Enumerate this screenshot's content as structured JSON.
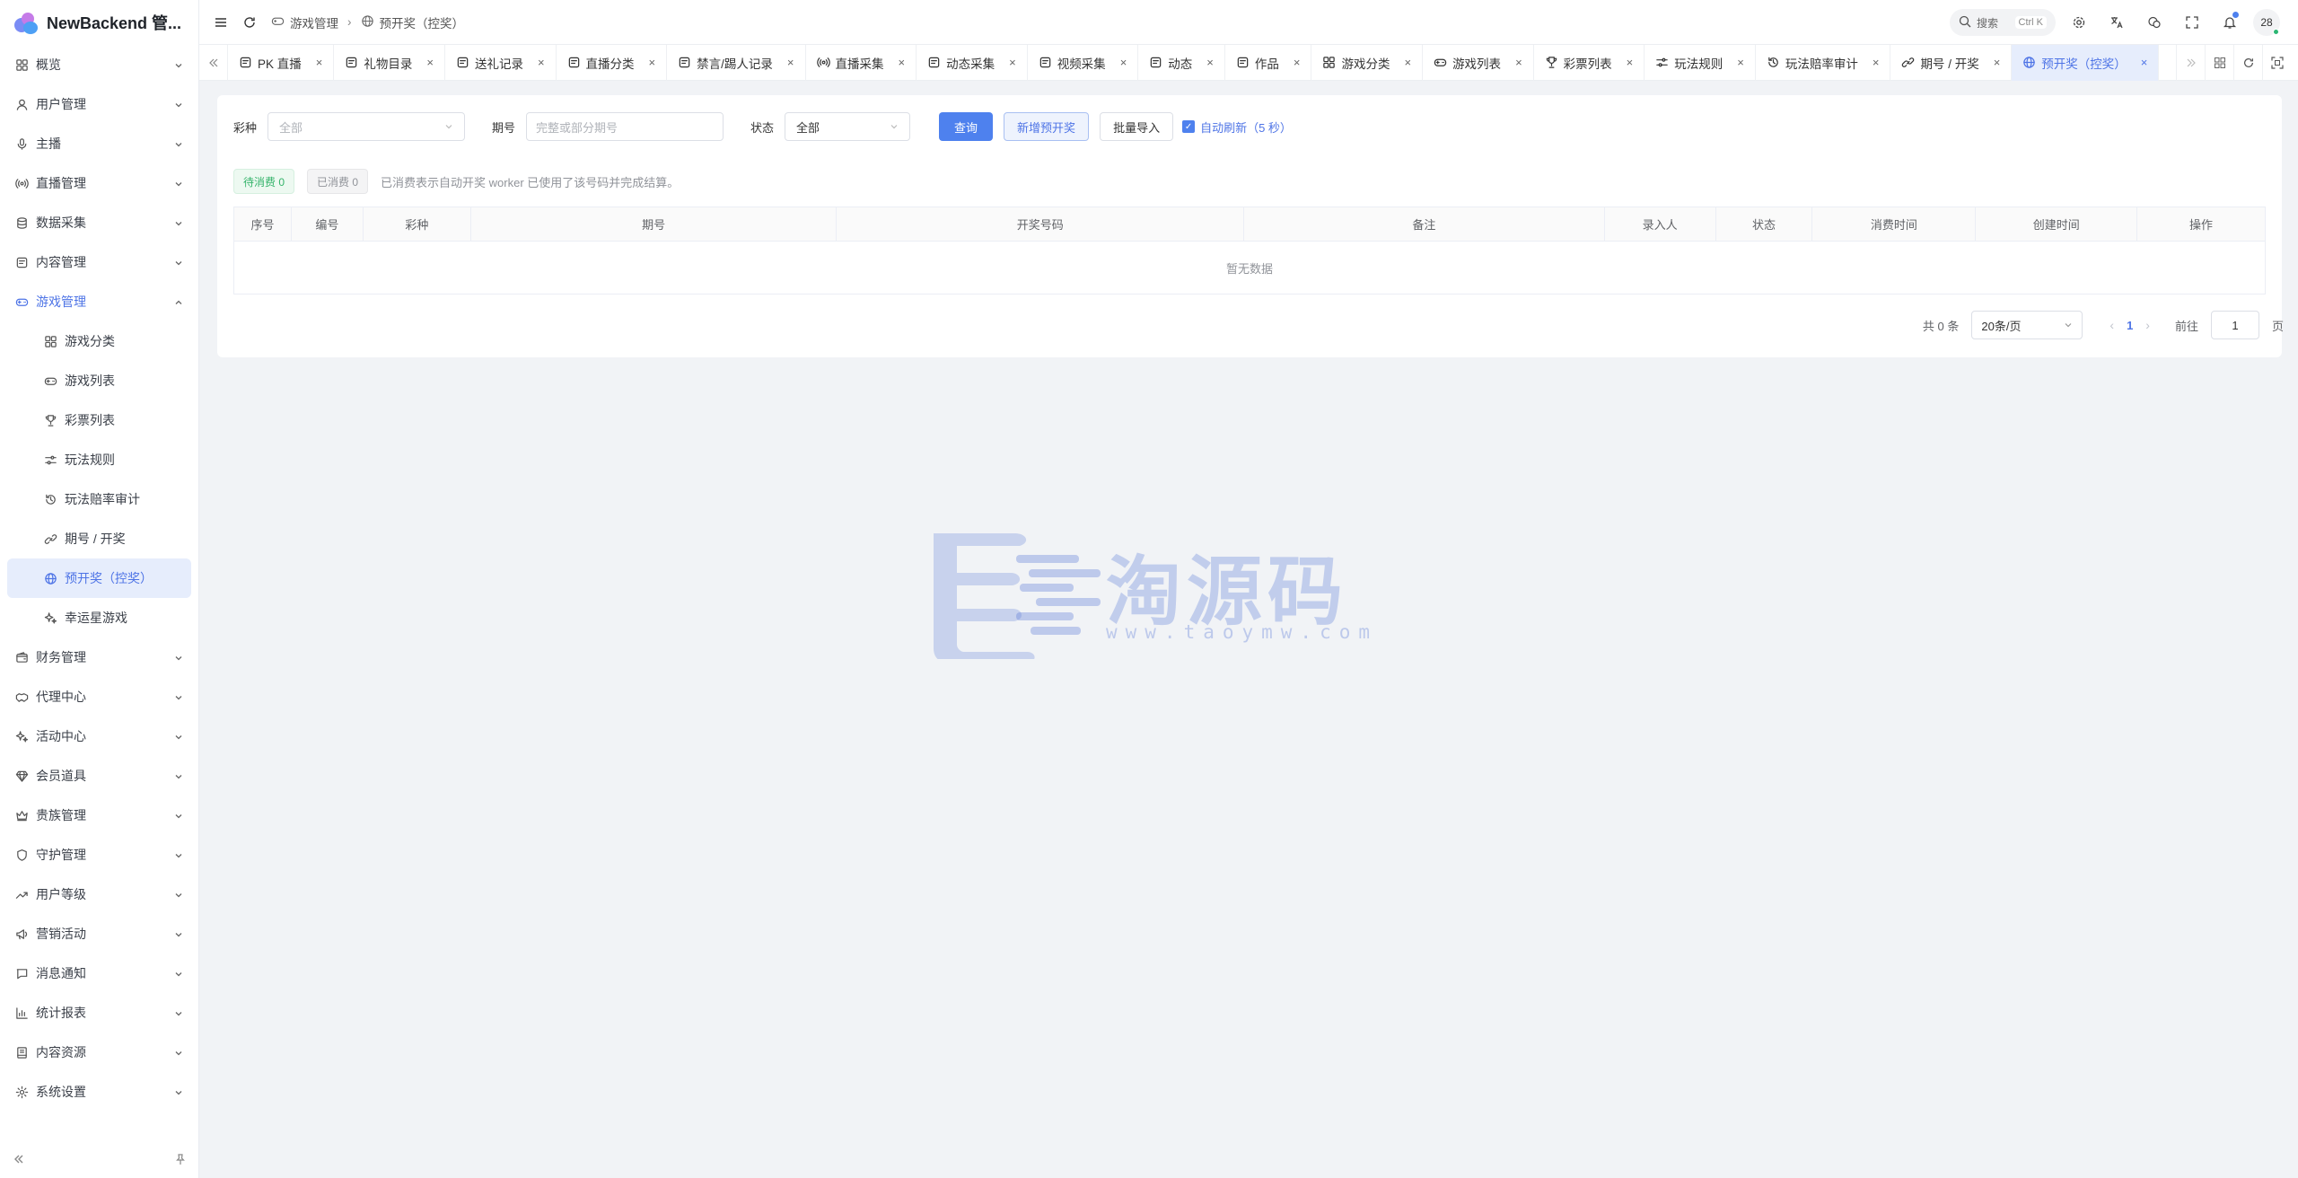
{
  "app": {
    "title": "NewBackend 管..."
  },
  "sidebar": {
    "items": [
      {
        "label": "概览",
        "icon": "grid-icon"
      },
      {
        "label": "用户管理",
        "icon": "user-icon"
      },
      {
        "label": "主播",
        "icon": "mic-icon"
      },
      {
        "label": "直播管理",
        "icon": "broadcast-icon"
      },
      {
        "label": "数据采集",
        "icon": "database-icon"
      },
      {
        "label": "内容管理",
        "icon": "content-icon"
      },
      {
        "label": "游戏管理",
        "icon": "gamepad-icon",
        "expanded": true
      }
    ],
    "sub_items": [
      {
        "label": "游戏分类",
        "icon": "grid-icon"
      },
      {
        "label": "游戏列表",
        "icon": "gamepad-icon"
      },
      {
        "label": "彩票列表",
        "icon": "trophy-icon"
      },
      {
        "label": "玩法规则",
        "icon": "rules-icon"
      },
      {
        "label": "玩法赔率审计",
        "icon": "history-icon"
      },
      {
        "label": "期号 / 开奖",
        "icon": "link-icon"
      },
      {
        "label": "预开奖（控奖）",
        "icon": "globe-icon",
        "active": true
      },
      {
        "label": "幸运星游戏",
        "icon": "sparkle-icon"
      }
    ],
    "items_after": [
      {
        "label": "财务管理",
        "icon": "wallet-icon"
      },
      {
        "label": "代理中心",
        "icon": "handshake-icon"
      },
      {
        "label": "活动中心",
        "icon": "sparkle-icon"
      },
      {
        "label": "会员道具",
        "icon": "gem-icon"
      },
      {
        "label": "贵族管理",
        "icon": "crown-icon"
      },
      {
        "label": "守护管理",
        "icon": "shield-icon"
      },
      {
        "label": "用户等级",
        "icon": "trend-icon"
      },
      {
        "label": "营销活动",
        "icon": "megaphone-icon"
      },
      {
        "label": "消息通知",
        "icon": "message-icon"
      },
      {
        "label": "统计报表",
        "icon": "chart-icon"
      },
      {
        "label": "内容资源",
        "icon": "book-icon"
      },
      {
        "label": "系统设置",
        "icon": "gear-icon"
      }
    ]
  },
  "header": {
    "breadcrumb": [
      "游戏管理",
      "预开奖（控奖）"
    ],
    "search_label": "搜索",
    "search_kbd": "Ctrl K",
    "avatar_text": "28"
  },
  "tabs": [
    {
      "label": "PK 直播"
    },
    {
      "label": "礼物目录"
    },
    {
      "label": "送礼记录"
    },
    {
      "label": "直播分类"
    },
    {
      "label": "禁言/踢人记录"
    },
    {
      "label": "直播采集"
    },
    {
      "label": "动态采集"
    },
    {
      "label": "视频采集"
    },
    {
      "label": "动态"
    },
    {
      "label": "作品"
    },
    {
      "label": "游戏分类"
    },
    {
      "label": "游戏列表"
    },
    {
      "label": "彩票列表"
    },
    {
      "label": "玩法规则"
    },
    {
      "label": "玩法赔率审计"
    },
    {
      "label": "期号 / 开奖"
    },
    {
      "label": "预开奖（控奖）",
      "active": true
    }
  ],
  "filters": {
    "lottery_label": "彩种",
    "lottery_placeholder": "全部",
    "period_label": "期号",
    "period_placeholder": "完整或部分期号",
    "status_label": "状态",
    "status_value": "全部",
    "query_button": "查询",
    "add_button": "新增预开奖",
    "import_button": "批量导入",
    "auto_refresh_label": "自动刷新（5 秒）",
    "auto_refresh_checked": true
  },
  "badges": {
    "pending": "待消费 0",
    "consumed": "已消费 0",
    "hint": "已消费表示自动开奖 worker 已使用了该号码并完成结算。"
  },
  "table": {
    "columns": [
      "序号",
      "编号",
      "彩种",
      "期号",
      "开奖号码",
      "备注",
      "录入人",
      "状态",
      "消费时间",
      "创建时间",
      "操作"
    ],
    "empty_text": "暂无数据"
  },
  "pagination": {
    "total": "共 0 条",
    "page_size": "20条/页",
    "current_page": "1",
    "goto_label": "前往",
    "goto_value": "1",
    "page_suffix": "页"
  },
  "watermark": {
    "text": "淘源码",
    "url": "www.taoymw.com"
  },
  "colors": {
    "accent": "#4e81ee",
    "active_bg": "#e6edfc",
    "success": "#34b36a"
  }
}
